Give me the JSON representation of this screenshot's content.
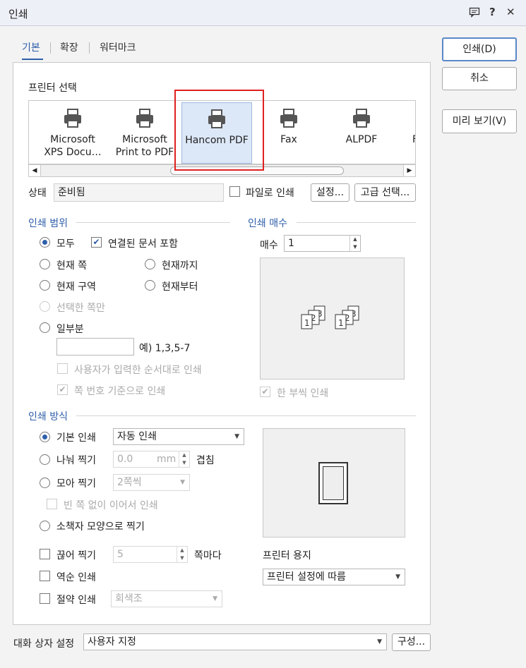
{
  "dialog": {
    "title": "인쇄"
  },
  "titlebar_icons": [
    "comment-icon",
    "help-icon",
    "close-icon"
  ],
  "titlebar_glyphs": {
    "help": "?",
    "close": "✕"
  },
  "tabs": [
    {
      "label": "기본",
      "active": true
    },
    {
      "label": "확장",
      "active": false
    },
    {
      "label": "워터마크",
      "active": false
    }
  ],
  "side_buttons": {
    "print": "인쇄(D)",
    "cancel": "취소",
    "preview": "미리 보기(V)"
  },
  "printer_section": {
    "title": "프린터 선택",
    "printers": [
      {
        "line1": "Microsoft",
        "line2": "XPS Docu…",
        "selected": false
      },
      {
        "line1": "Microsoft",
        "line2": "Print to PDF",
        "selected": false
      },
      {
        "line1": "Hancom PDF",
        "line2": "",
        "selected": true
      },
      {
        "line1": "Fax",
        "line2": "",
        "selected": false
      },
      {
        "line1": "ALPDF",
        "line2": "",
        "selected": false
      },
      {
        "line1": "F",
        "line2": "",
        "selected": false
      }
    ],
    "status_label": "상태",
    "status_value": "준비됨",
    "file_print_label": "파일로 인쇄",
    "settings_button": "설정...",
    "advanced_button": "고급 선택..."
  },
  "print_range": {
    "title": "인쇄 범위",
    "all": "모두",
    "include_linked": "연결된 문서 포함",
    "current_page": "현재 쪽",
    "until_current": "현재까지",
    "current_section": "현재 구역",
    "from_current": "현재부터",
    "selected_only": "선택한 쪽만",
    "partial": "일부분",
    "partial_example": "예) 1,3,5-7",
    "user_order": "사용자가 입력한 순서대로 인쇄",
    "page_number_basis": "쪽 번호 기준으로 인쇄"
  },
  "copies": {
    "title": "인쇄 매수",
    "label": "매수",
    "value": "1",
    "collate": "한 부씩 인쇄",
    "collate_icon_digits": [
      "1",
      "2",
      "3"
    ]
  },
  "print_method": {
    "title": "인쇄 방식",
    "basic": "기본 인쇄",
    "basic_select": "자동 인쇄",
    "split": "나눠 찍기",
    "split_value": "0.0",
    "split_unit": "mm",
    "overlap": "겹침",
    "gather": "모아 찍기",
    "gather_select": "2쪽씩",
    "no_blank": "빈 쪽 없이 이어서 인쇄",
    "booklet": "소책자 모양으로 찍기",
    "break": "끊어 찍기",
    "break_value": "5",
    "per_page": "쪽마다",
    "reverse": "역순 인쇄",
    "saving": "절약 인쇄",
    "saving_select": "회색조",
    "paper_label": "프린터 용지",
    "paper_select": "프린터 설정에 따름"
  },
  "footer": {
    "label": "대화 상자 설정",
    "select": "사용자 지정",
    "configure_button": "구성..."
  }
}
